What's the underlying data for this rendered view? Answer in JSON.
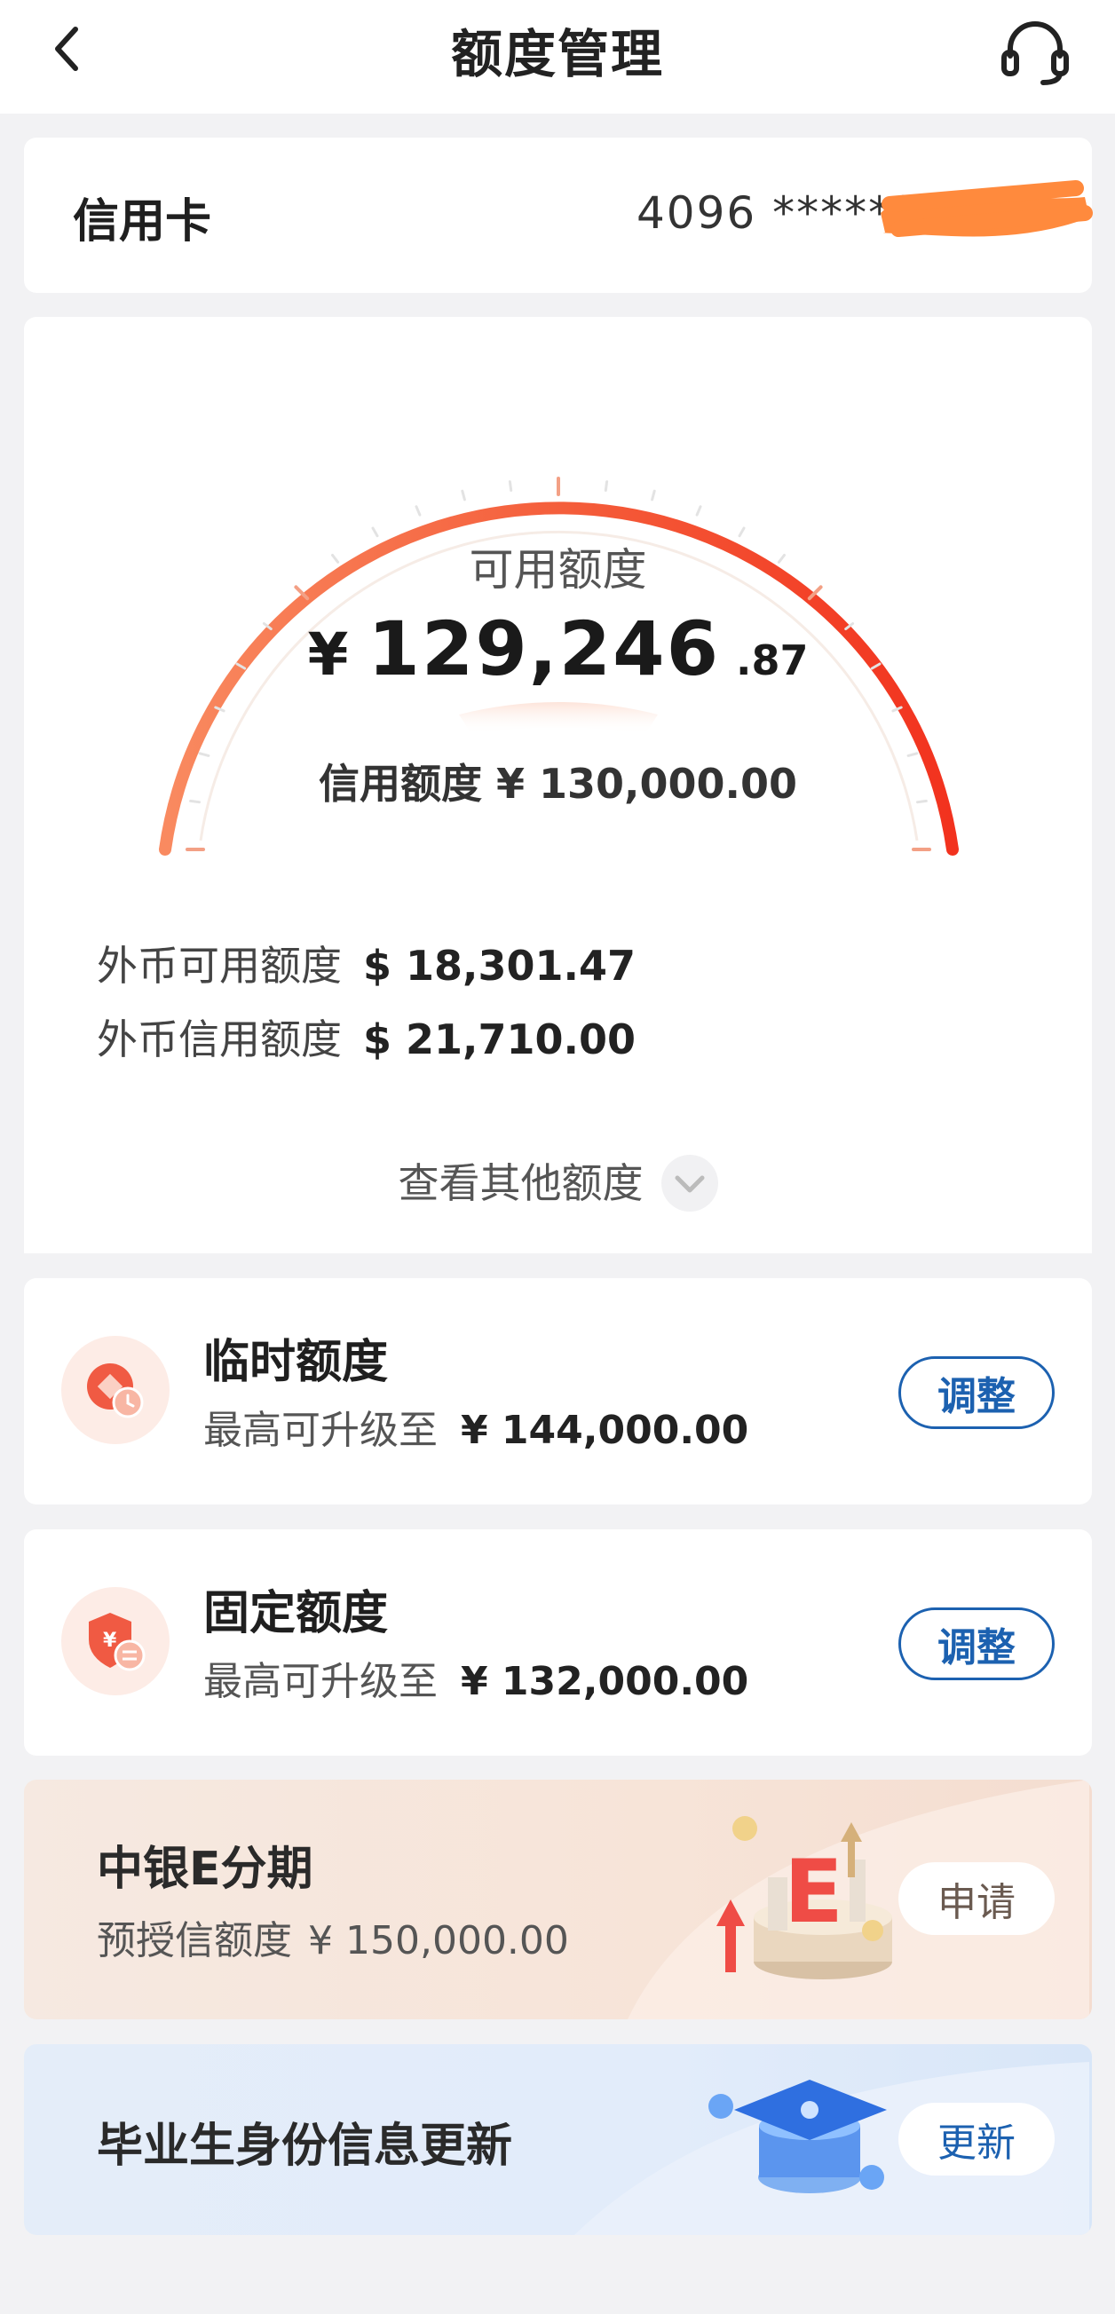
{
  "header": {
    "title": "额度管理"
  },
  "card": {
    "label": "信用卡",
    "number": "4096 ******"
  },
  "available": {
    "label": "可用额度",
    "currency": "¥",
    "amount_int": "129,246",
    "amount_dec": ".87"
  },
  "credit_limit": {
    "text": "信用额度 ¥ 130,000.00"
  },
  "gauge": {
    "used_fraction": 0.0058,
    "colors": {
      "start": "#f98a60",
      "end": "#f2321e"
    }
  },
  "foreign": {
    "available_label": "外币可用额度",
    "available_value": "$ 18,301.47",
    "limit_label": "外币信用额度",
    "limit_value": "$ 21,710.00"
  },
  "more": {
    "label": "查看其他额度"
  },
  "temporary_quota": {
    "title": "临时额度",
    "sub_label": "最高可升级至",
    "sub_value": "¥ 144,000.00",
    "button": "调整",
    "icon": "coin-clock-icon"
  },
  "fixed_quota": {
    "title": "固定额度",
    "sub_label": "最高可升级至",
    "sub_value": "¥ 132,000.00",
    "button": "调整",
    "icon": "shield-yen-icon"
  },
  "installment_promo": {
    "title": "中银E分期",
    "sub_label": "预授信额度",
    "sub_value": "¥ 150,000.00",
    "button": "申请",
    "illustration_letter": "E"
  },
  "graduate_promo": {
    "title": "毕业生身份信息更新",
    "button": "更新"
  },
  "colors": {
    "accent_blue": "#1c61b0",
    "gauge_red": "#f2321e",
    "redaction": "#ff8a3d"
  }
}
